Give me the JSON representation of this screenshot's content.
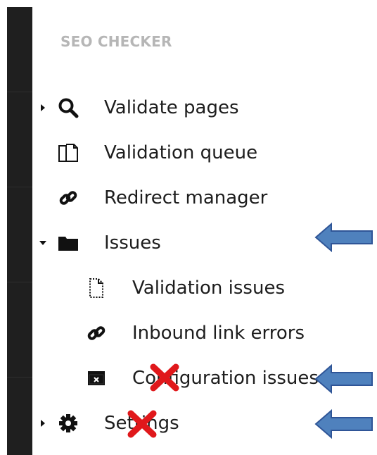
{
  "sidebar": {
    "header": "SEO CHECKER",
    "items": [
      {
        "label": "Validate pages",
        "icon": "search-icon",
        "caret": "collapsed"
      },
      {
        "label": "Validation queue",
        "icon": "document-copy-icon"
      },
      {
        "label": "Redirect manager",
        "icon": "link-icon"
      },
      {
        "label": "Issues",
        "icon": "folder-icon",
        "caret": "expanded",
        "children": [
          {
            "label": "Validation issues",
            "icon": "document-dotted-icon"
          },
          {
            "label": "Inbound link errors",
            "icon": "link-icon"
          },
          {
            "label": "Configuration issues",
            "icon": "window-close-icon"
          }
        ]
      },
      {
        "label": "Settings",
        "icon": "gear-icon",
        "caret": "collapsed"
      }
    ]
  },
  "annotations": {
    "arrow_color": "#4f81bd",
    "cross_color": "#e0181b"
  }
}
